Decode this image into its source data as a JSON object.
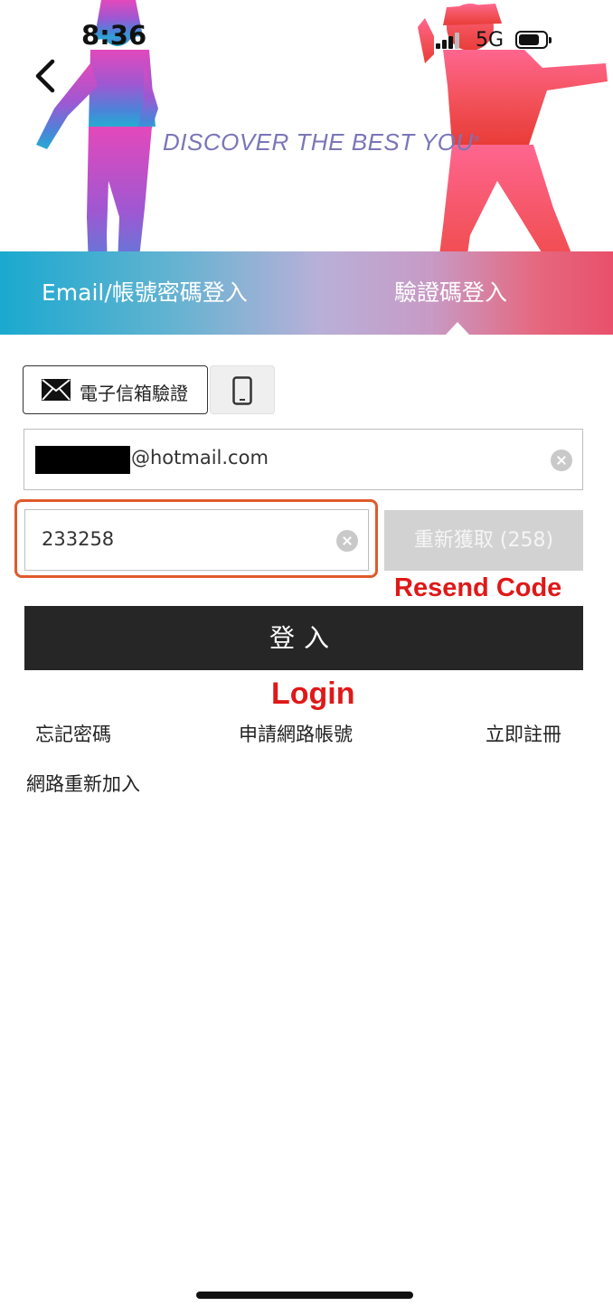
{
  "status_bar": {
    "time": "8:36",
    "network": "5G"
  },
  "hero": {
    "tagline": "DISCOVER THE BEST YOU",
    "tagline_mark": "®"
  },
  "tabs": [
    {
      "label": "Email/帳號密碼登入"
    },
    {
      "label": "驗證碼登入",
      "active": true
    }
  ],
  "method_toggle": {
    "email_label": "電子信箱驗證"
  },
  "form": {
    "email_value": "@hotmail.com",
    "code_value": "233258",
    "resend_label": "重新獲取 (258)",
    "login_label": "登入"
  },
  "annotations": {
    "resend": "Resend Code",
    "login": "Login"
  },
  "links": {
    "forgot": "忘記密碼",
    "apply": "申請網路帳號",
    "register": "立即註冊",
    "rejoin": "網路重新加入"
  }
}
